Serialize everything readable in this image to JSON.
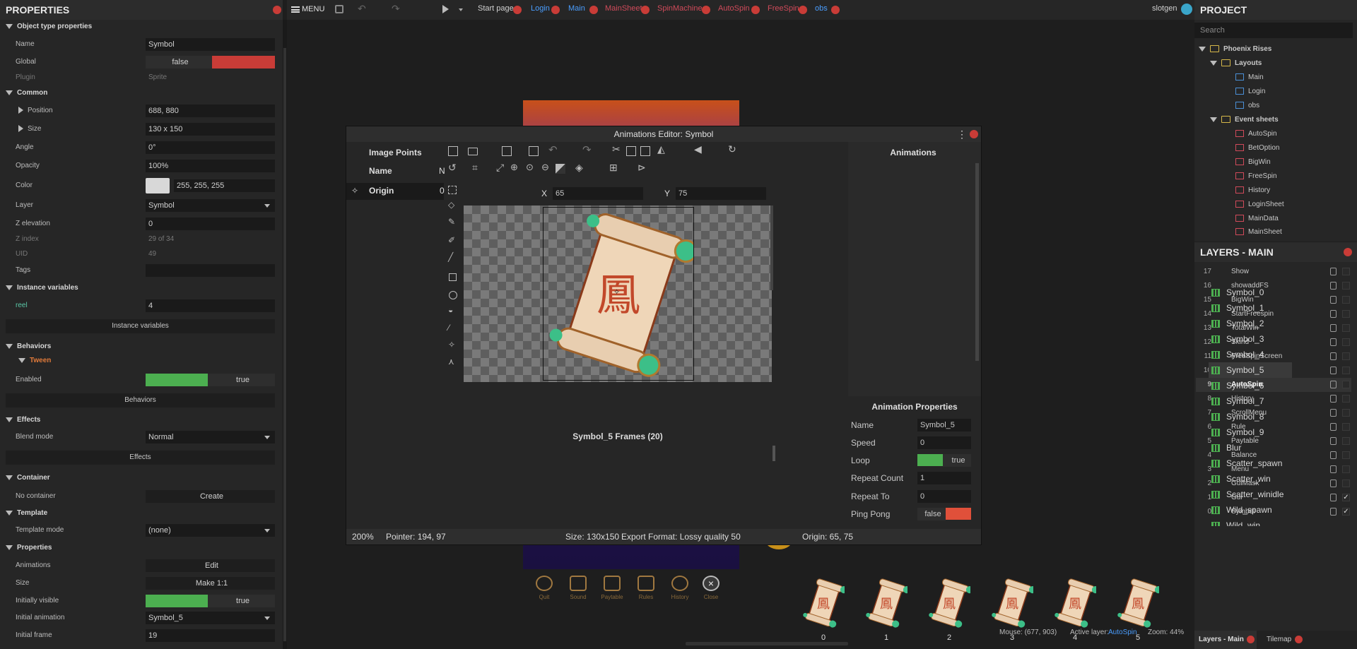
{
  "topbar": {
    "menu_label": "MENU",
    "tabs": [
      "Start page",
      "Login",
      "Main",
      "MainSheet",
      "SpinMachine",
      "AutoSpin",
      "FreeSpin",
      "obs"
    ],
    "user": "slotgen"
  },
  "properties": {
    "title": "PROPERTIES",
    "sec_object": "Object type properties",
    "name_label": "Name",
    "name_value": "Symbol",
    "global_label": "Global",
    "global_value": "false",
    "plugin_label": "Plugin",
    "plugin_value": "Sprite",
    "sec_common": "Common",
    "position_label": "Position",
    "position_value": "688, 880",
    "size_label": "Size",
    "size_value": "130 x 150",
    "angle_label": "Angle",
    "angle_value": "0°",
    "opacity_label": "Opacity",
    "opacity_value": "100%",
    "color_label": "Color",
    "color_value": "255, 255, 255",
    "layer_label": "Layer",
    "layer_value": "Symbol",
    "zelev_label": "Z elevation",
    "zelev_value": "0",
    "zindex_label": "Z index",
    "zindex_value": "29 of 34",
    "uid_label": "UID",
    "uid_value": "49",
    "tags_label": "Tags",
    "tags_value": "",
    "sec_instvars": "Instance variables",
    "reel_label": "reel",
    "reel_value": "4",
    "instvars_btn": "Instance variables",
    "sec_behaviors": "Behaviors",
    "tween_label": "Tween",
    "enabled_label": "Enabled",
    "enabled_value": "true",
    "behaviors_btn": "Behaviors",
    "sec_effects": "Effects",
    "blend_label": "Blend mode",
    "blend_value": "Normal",
    "effects_btn": "Effects",
    "sec_container": "Container",
    "nocontainer_label": "No container",
    "create_btn": "Create",
    "sec_template": "Template",
    "tmode_label": "Template mode",
    "tmode_value": "(none)",
    "sec_properties": "Properties",
    "animations_label": "Animations",
    "animations_btn": "Edit",
    "size2_label": "Size",
    "size2_btn": "Make 1:1",
    "initvis_label": "Initially visible",
    "initvis_value": "true",
    "initanim_label": "Initial animation",
    "initanim_value": "Symbol_5",
    "initframe_label": "Initial frame",
    "initframe_value": "19"
  },
  "project": {
    "title": "PROJECT",
    "search_placeholder": "Search",
    "root": "Phoenix Rises",
    "layouts_label": "Layouts",
    "layouts": [
      "Main",
      "Login",
      "obs"
    ],
    "eventsheets_label": "Event sheets",
    "eventsheets": [
      "AutoSpin",
      "BetOption",
      "BigWin",
      "FreeSpin",
      "History",
      "LoginSheet",
      "MainData",
      "MainSheet"
    ]
  },
  "layers": {
    "title": "LAYERS - MAIN",
    "items": [
      {
        "n": "17",
        "name": "Show"
      },
      {
        "n": "16",
        "name": "showaddFS"
      },
      {
        "n": "15",
        "name": "BigWin"
      },
      {
        "n": "14",
        "name": "StartFreespin"
      },
      {
        "n": "13",
        "name": "TotalWin"
      },
      {
        "n": "12",
        "name": "Skind"
      },
      {
        "n": "11",
        "name": "FreeSpinScreen"
      },
      {
        "n": "10",
        "name": "BetOption"
      },
      {
        "n": "9",
        "name": "AutoSpin"
      },
      {
        "n": "8",
        "name": "History"
      },
      {
        "n": "7",
        "name": "ScrollMenu"
      },
      {
        "n": "6",
        "name": "Rule"
      },
      {
        "n": "5",
        "name": "Paytable"
      },
      {
        "n": "4",
        "name": "Balance"
      },
      {
        "n": "3",
        "name": "Menu"
      },
      {
        "n": "2",
        "name": "GuiMask"
      },
      {
        "n": "1",
        "name": "Gui"
      },
      {
        "n": "0",
        "name": "Symbol"
      }
    ],
    "check_mark": "✓"
  },
  "dialog": {
    "title": "Animations Editor: Symbol",
    "image_points_title": "Image Points",
    "name_col": "Name",
    "name_col_cut": "N",
    "origin_label": "Origin",
    "origin_cut": "0",
    "x_label": "X",
    "x_value": "65",
    "y_label": "Y",
    "y_value": "75",
    "glyph": "鳳",
    "animations_title": "Animations",
    "animations": [
      "Symbol_0",
      "Symbol_1",
      "Symbol_2",
      "Symbol_3",
      "Symbol_4",
      "Symbol_5",
      "Symbol_6",
      "Symbol_7",
      "Symbol_8",
      "Symbol_9",
      "Blur",
      "Scatter_spawn",
      "Scatter_win",
      "Scatter_winidle",
      "Wild_spawn",
      "Wild_win"
    ],
    "anim_props_title": "Animation Properties",
    "ap_name_label": "Name",
    "ap_name_value": "Symbol_5",
    "ap_speed_label": "Speed",
    "ap_speed_value": "0",
    "ap_loop_label": "Loop",
    "ap_loop_value": "true",
    "ap_repcount_label": "Repeat Count",
    "ap_repcount_value": "1",
    "ap_repto_label": "Repeat To",
    "ap_repto_value": "0",
    "ap_pingpong_label": "Ping Pong",
    "ap_pingpong_value": "false",
    "frames_title": "Symbol_5 Frames (20)",
    "frames": [
      "0",
      "1",
      "2",
      "3",
      "4",
      "5"
    ],
    "status_zoom": "200%",
    "status_pointer": "Pointer: 194, 97",
    "status_size": "Size: 130x150",
    "status_export": "Export Format: Lossy quality 50",
    "status_origin": "Origin: 65, 75"
  },
  "gamebar": {
    "buttons": [
      "Quit",
      "Sound",
      "Paytable",
      "Rules",
      "History",
      "Close"
    ]
  },
  "statusbar": {
    "mouse": "Mouse: (677, 903)",
    "active_layer_label": "Active layer:",
    "active_layer_value": "AutoSpin",
    "zoom": "Zoom: 44%"
  },
  "bottomtabs": {
    "layers_tab": "Layers - Main",
    "tilemap_tab": "Tilemap"
  },
  "colors": {
    "accent_green": "#4caf50",
    "accent_red": "#c93c37",
    "link_blue": "#4a9eff",
    "section_orange": "#e07a3a"
  }
}
